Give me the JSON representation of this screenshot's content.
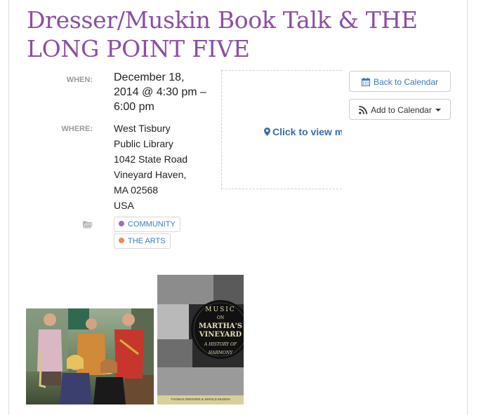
{
  "event": {
    "title": "Dresser/Muskin Book Talk & THE LONG POINT FIVE",
    "when_label": "WHEN:",
    "when_value": "December 18, 2014 @ 4:30 pm – 6:00 pm",
    "where_label": "WHERE:",
    "where_lines": [
      "West Tisbury",
      "Public Library",
      "1042 State Road",
      "Vineyard Haven,",
      "MA 02568",
      "USA"
    ],
    "categories": [
      {
        "label": "COMMUNITY",
        "color": "#9b6fc0"
      },
      {
        "label": "THE ARTS",
        "color": "#f08a5a"
      }
    ]
  },
  "map": {
    "link_text": "Click to view m"
  },
  "actions": {
    "back_label": "Back to Calendar",
    "add_label": "Add to Calendar"
  },
  "images": {
    "book_cover": {
      "title_lines": [
        "MUSIC",
        "ON",
        "MARTHA'S",
        "VINEYARD"
      ],
      "subtitle_lines": [
        "A HISTORY OF",
        "HARMONY"
      ],
      "authors": "THOMAS DRESSER & JEROLD MUSKIN"
    }
  },
  "colors": {
    "title": "#8a4fa3",
    "link": "#3a7ac0"
  }
}
